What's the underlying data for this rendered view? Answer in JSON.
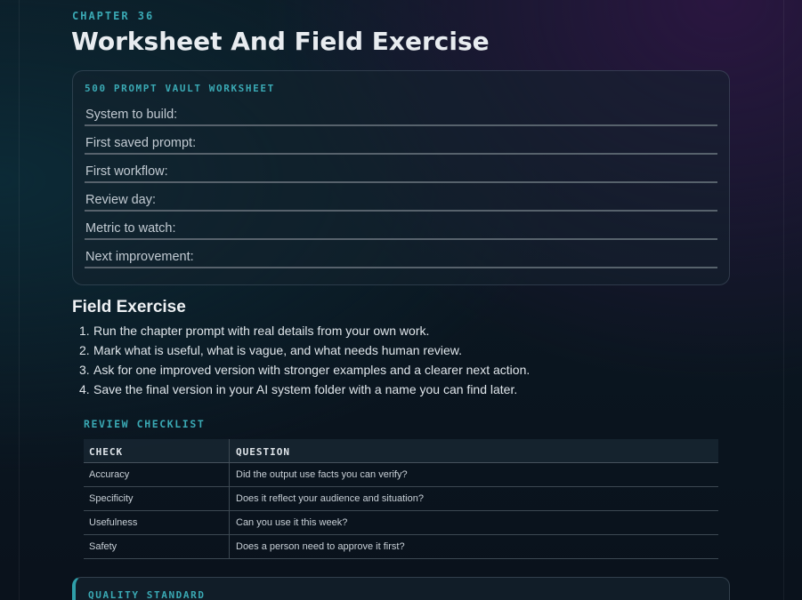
{
  "chapter_label": "CHAPTER 36",
  "title": "Worksheet And Field Exercise",
  "worksheet": {
    "title": "500 PROMPT VAULT WORKSHEET",
    "fields": [
      "System to build:",
      "First saved prompt:",
      "First workflow:",
      "Review day:",
      "Metric to watch:",
      "Next improvement:"
    ]
  },
  "field_exercise": {
    "title": "Field Exercise",
    "steps": [
      {
        "num": "1.",
        "text": "Run the chapter prompt with real details from your own work."
      },
      {
        "num": "2.",
        "text": "Mark what is useful, what is vague, and what needs human review."
      },
      {
        "num": "3.",
        "text": "Ask for one improved version with stronger examples and a clearer next action."
      },
      {
        "num": "4.",
        "text": "Save the final version in your AI system folder with a name you can find later."
      }
    ]
  },
  "review_checklist": {
    "title": "REVIEW CHECKLIST",
    "headers": [
      "CHECK",
      "QUESTION"
    ],
    "rows": [
      [
        "Accuracy",
        "Did the output use facts you can verify?"
      ],
      [
        "Specificity",
        "Does it reflect your audience and situation?"
      ],
      [
        "Usefulness",
        "Can you use it this week?"
      ],
      [
        "Safety",
        "Does a person need to approve it first?"
      ]
    ]
  },
  "quality_standard": {
    "title": "QUALITY STANDARD"
  },
  "colors": {
    "accent": "#3aa9b4",
    "title": "#e8ecf0",
    "background": "#0b1a24"
  }
}
